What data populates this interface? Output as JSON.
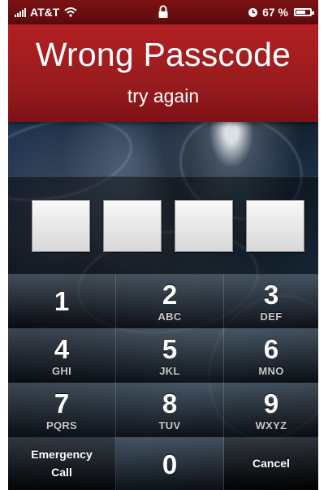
{
  "status_bar": {
    "carrier": "AT&T",
    "battery_percent": "67 %",
    "battery_level": 0.67,
    "icons": [
      "signal-icon",
      "wifi-icon",
      "lock-icon",
      "clock-icon",
      "battery-icon"
    ]
  },
  "header": {
    "title": "Wrong Passcode",
    "subtitle": "try again",
    "color": "#a51f22"
  },
  "passcode": {
    "box_count": 4,
    "values": [
      "",
      "",
      "",
      ""
    ]
  },
  "keypad": {
    "keys": [
      {
        "number": "1",
        "letters": ""
      },
      {
        "number": "2",
        "letters": "ABC"
      },
      {
        "number": "3",
        "letters": "DEF"
      },
      {
        "number": "4",
        "letters": "GHI"
      },
      {
        "number": "5",
        "letters": "JKL"
      },
      {
        "number": "6",
        "letters": "MNO"
      },
      {
        "number": "7",
        "letters": "PQRS"
      },
      {
        "number": "8",
        "letters": "TUV"
      },
      {
        "number": "9",
        "letters": "WXYZ"
      }
    ],
    "emergency_line1": "Emergency",
    "emergency_line2": "Call",
    "zero": "0",
    "cancel": "Cancel"
  }
}
